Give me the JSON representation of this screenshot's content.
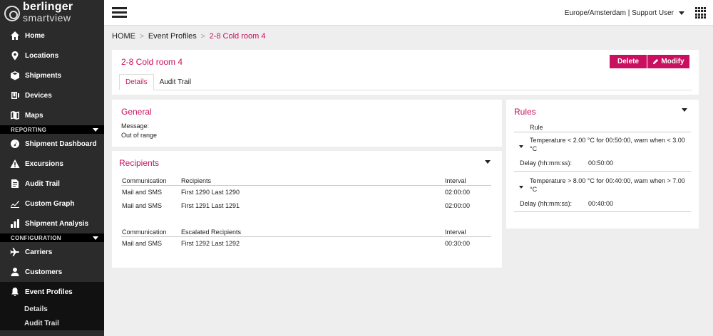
{
  "logo": {
    "brand": "berlinger",
    "sub": "smartview"
  },
  "nav": {
    "items_top": [
      {
        "label": "Home",
        "icon": "home-icon"
      },
      {
        "label": "Locations",
        "icon": "pin-icon"
      },
      {
        "label": "Shipments",
        "icon": "box-icon"
      },
      {
        "label": "Devices",
        "icon": "device-icon"
      },
      {
        "label": "Maps",
        "icon": "map-icon"
      }
    ],
    "reporting_label": "REPORTING",
    "items_reporting": [
      {
        "label": "Shipment Dashboard",
        "icon": "gauge-icon"
      },
      {
        "label": "Excursions",
        "icon": "warning-icon"
      },
      {
        "label": "Audit Trail",
        "icon": "document-icon"
      },
      {
        "label": "Custom Graph",
        "icon": "chart-icon"
      },
      {
        "label": "Shipment Analysis",
        "icon": "bar-chart-icon"
      }
    ],
    "configuration_label": "CONFIGURATION",
    "items_config": [
      {
        "label": "Carriers",
        "icon": "plane-icon"
      },
      {
        "label": "Customers",
        "icon": "user-icon"
      },
      {
        "label": "Event Profiles",
        "icon": "bell-icon"
      }
    ],
    "sub_items": [
      "Details",
      "Audit Trail"
    ]
  },
  "topbar": {
    "user": "Europe/Amsterdam | Support User"
  },
  "breadcrumb": {
    "home": "HOME",
    "section": "Event Profiles",
    "current": "2-8 Cold room 4"
  },
  "header": {
    "title": "2-8 Cold room 4",
    "delete_label": "Delete",
    "modify_label": "Modify",
    "tabs": [
      "Details",
      "Audit Trail"
    ]
  },
  "general": {
    "title": "General",
    "message_label": "Message:",
    "message_value": "Out of range"
  },
  "recipients": {
    "title": "Recipients",
    "table1": {
      "headers": [
        "Communication",
        "Recipients",
        "Interval"
      ],
      "rows": [
        [
          "Mail and SMS",
          "First 1290 Last 1290",
          "02:00:00"
        ],
        [
          "Mail and SMS",
          "First 1291 Last 1291",
          "02:00:00"
        ]
      ]
    },
    "table2": {
      "headers": [
        "Communication",
        "Escalated Recipients",
        "Interval"
      ],
      "rows": [
        [
          "Mail and SMS",
          "First 1292 Last 1292",
          "00:30:00"
        ]
      ]
    }
  },
  "rules": {
    "title": "Rules",
    "header": "Rule",
    "delay_label": "Delay (hh:mm:ss):",
    "items": [
      {
        "text": "Temperature < 2.00 °C for 00:50:00, warn when < 3.00 °C",
        "delay": "00:50:00"
      },
      {
        "text": "Temperature > 8.00 °C for 00:40:00, warn when > 7.00 °C",
        "delay": "00:40:00"
      }
    ]
  },
  "colors": {
    "accent": "#c8105f",
    "sidebar": "#2b2b2b"
  }
}
